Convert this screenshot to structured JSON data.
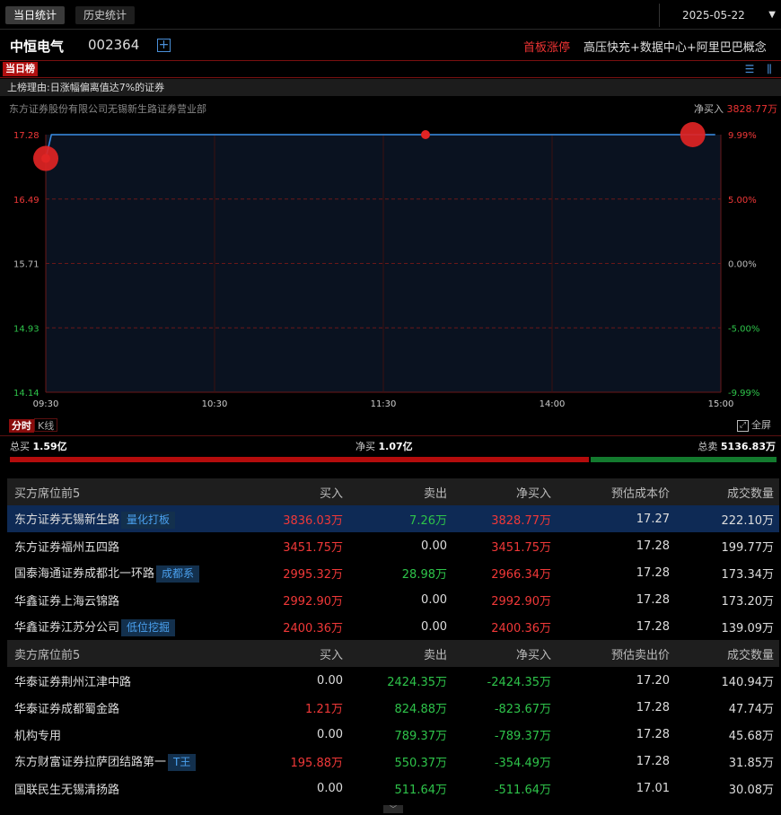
{
  "tabs": {
    "today": "当日统计",
    "history": "历史统计"
  },
  "date": "2025-05-22",
  "stock": {
    "name": "中恒电气",
    "code": "002364",
    "limit_tag": "首板涨停",
    "concepts": "高压快充+数据中心+阿里巴巴概念"
  },
  "board_tag": "当日榜",
  "reason": "上榜理由:日涨幅偏离值达7%的证券",
  "broker": "东方证券股份有限公司无锡新生路证券营业部",
  "net_buy": {
    "label": "净买入",
    "value": "3828.77万"
  },
  "chart_data": {
    "type": "line",
    "x_ticks": [
      "09:30",
      "10:30",
      "11:30",
      "14:00",
      "15:00"
    ],
    "y_left_ticks": [
      "17.28",
      "16.49",
      "15.71",
      "14.93",
      "14.14"
    ],
    "y_right_ticks": [
      "9.99%",
      "5.00%",
      "0.00%",
      "-5.00%",
      "-9.99%"
    ],
    "ylim": [
      14.14,
      17.28
    ],
    "series": [
      {
        "x": [
          0,
          2,
          238
        ],
        "y": [
          16.99,
          17.28,
          17.28
        ]
      }
    ],
    "markers": [
      {
        "x": 0,
        "y": 16.99,
        "size": "large"
      },
      {
        "x": 0,
        "y": 16.99,
        "size": "small"
      },
      {
        "x": 135,
        "y": 17.28,
        "size": "small"
      },
      {
        "x": 230,
        "y": 17.28,
        "size": "large"
      }
    ],
    "colors": {
      "line": "#3a8fe8",
      "marker": "#e02424",
      "up": "#f03838",
      "down": "#2ec34a"
    }
  },
  "time_tabs": {
    "intraday": "分时",
    "kline": "K线"
  },
  "fullscreen": "全屏",
  "totals": {
    "buy_label": "总买",
    "buy_value": "1.59亿",
    "net_label": "净买",
    "net_value": "1.07亿",
    "sell_label": "总卖",
    "sell_value": "5136.83万",
    "buy_ratio": 0.756
  },
  "buy_table": {
    "headers": [
      "买方席位前5",
      "买入",
      "卖出",
      "净买入",
      "预估成本价",
      "成交数量"
    ],
    "rows": [
      {
        "name": "东方证券无锡新生路",
        "tag": "量化打板",
        "buy": "3836.03万",
        "sell": "7.26万",
        "net": "3828.77万",
        "price": "17.27",
        "vol": "222.10万"
      },
      {
        "name": "东方证券福州五四路",
        "tag": "",
        "buy": "3451.75万",
        "sell": "0.00",
        "net": "3451.75万",
        "price": "17.28",
        "vol": "199.77万"
      },
      {
        "name": "国泰海通证券成都北一环路",
        "tag": "成都系",
        "buy": "2995.32万",
        "sell": "28.98万",
        "net": "2966.34万",
        "price": "17.28",
        "vol": "173.34万"
      },
      {
        "name": "华鑫证券上海云锦路",
        "tag": "",
        "buy": "2992.90万",
        "sell": "0.00",
        "net": "2992.90万",
        "price": "17.28",
        "vol": "173.20万"
      },
      {
        "name": "华鑫证券江苏分公司",
        "tag": "低位挖掘",
        "buy": "2400.36万",
        "sell": "0.00",
        "net": "2400.36万",
        "price": "17.28",
        "vol": "139.09万"
      }
    ]
  },
  "sell_table": {
    "headers": [
      "卖方席位前5",
      "买入",
      "卖出",
      "净买入",
      "预估卖出价",
      "成交数量"
    ],
    "rows": [
      {
        "name": "华泰证券荆州江津中路",
        "tag": "",
        "buy": "0.00",
        "sell": "2424.35万",
        "net": "-2424.35万",
        "price": "17.20",
        "vol": "140.94万"
      },
      {
        "name": "华泰证券成都蜀金路",
        "tag": "",
        "buy": "1.21万",
        "sell": "824.88万",
        "net": "-823.67万",
        "price": "17.28",
        "vol": "47.74万"
      },
      {
        "name": "机构专用",
        "tag": "",
        "buy": "0.00",
        "sell": "789.37万",
        "net": "-789.37万",
        "price": "17.28",
        "vol": "45.68万"
      },
      {
        "name": "东方财富证券拉萨团结路第一",
        "tag": "T王",
        "buy": "195.88万",
        "sell": "550.37万",
        "net": "-354.49万",
        "price": "17.28",
        "vol": "31.85万"
      },
      {
        "name": "国联民生无锡清扬路",
        "tag": "",
        "buy": "0.00",
        "sell": "511.64万",
        "net": "-511.64万",
        "price": "17.01",
        "vol": "30.08万"
      }
    ]
  }
}
